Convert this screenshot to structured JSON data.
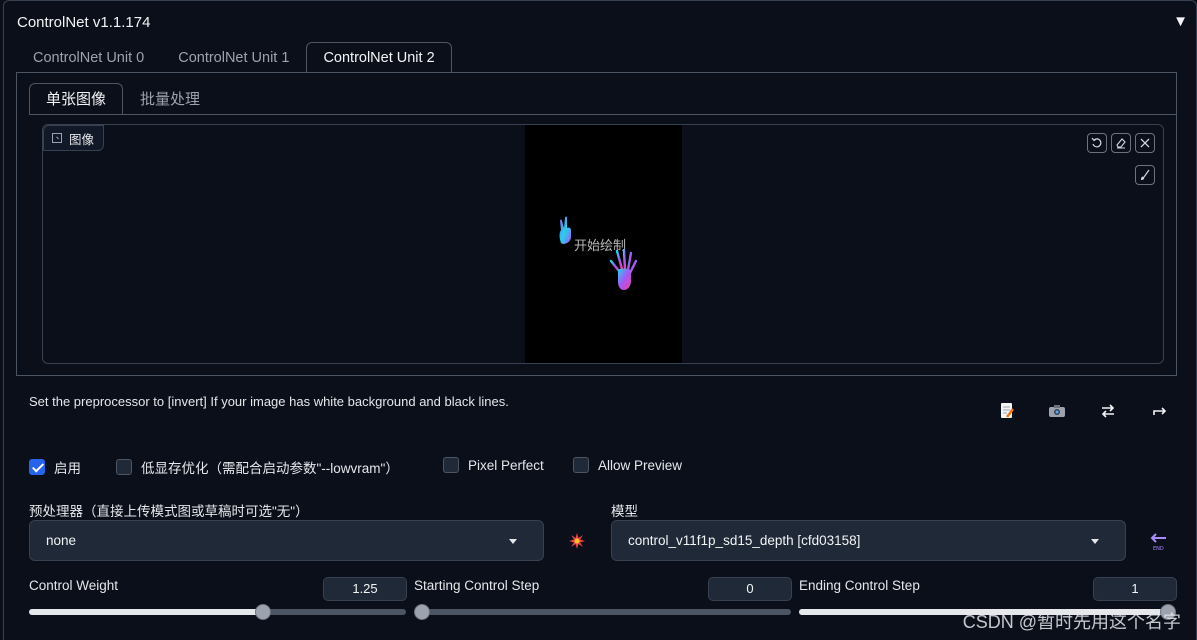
{
  "panel": {
    "title": "ControlNet v1.1.174",
    "collapse_glyph": "▼"
  },
  "unit_tabs": [
    {
      "label": "ControlNet Unit 0",
      "active": false
    },
    {
      "label": "ControlNet Unit 1",
      "active": false
    },
    {
      "label": "ControlNet Unit 2",
      "active": true
    }
  ],
  "sub_tabs": [
    {
      "label": "单张图像",
      "active": true
    },
    {
      "label": "批量处理",
      "active": false
    }
  ],
  "image_block": {
    "label": "图像",
    "canvas_text": "开始绘制"
  },
  "canvas_tools": [
    "undo-icon",
    "eraser-icon",
    "close-icon",
    "brush-icon"
  ],
  "hint": "Set the preprocessor to [invert] If your image has white background and black lines.",
  "action_icons": [
    "edit-note-icon",
    "camera-icon",
    "swap-icon",
    "send-dimensions-icon"
  ],
  "checkboxes": {
    "enable": {
      "label": "启用",
      "checked": true
    },
    "lowvram": {
      "label": "低显存优化（需配合启动参数\"--lowvram\"）",
      "checked": false
    },
    "pixel_perfect": {
      "label": "Pixel Perfect",
      "checked": false
    },
    "allow_preview": {
      "label": "Allow Preview",
      "checked": false
    }
  },
  "preprocessor": {
    "label": "预处理器（直接上传模式图或草稿时可选\"无\"）",
    "value": "none"
  },
  "model": {
    "label": "模型",
    "value": "control_v11f1p_sd15_depth [cfd03158]"
  },
  "sliders": {
    "control_weight": {
      "label": "Control Weight",
      "value": "1.25",
      "fraction": 0.625
    },
    "starting_step": {
      "label": "Starting Control Step",
      "value": "0",
      "fraction": 0.0
    },
    "ending_step": {
      "label": "Ending Control Step",
      "value": "1",
      "fraction": 1.0
    }
  },
  "watermark": "CSDN @暂时先用这个名字",
  "colors": {
    "accent": "#2563eb",
    "background": "#0b0f19",
    "surface": "#1f2937",
    "border": "#374151"
  }
}
